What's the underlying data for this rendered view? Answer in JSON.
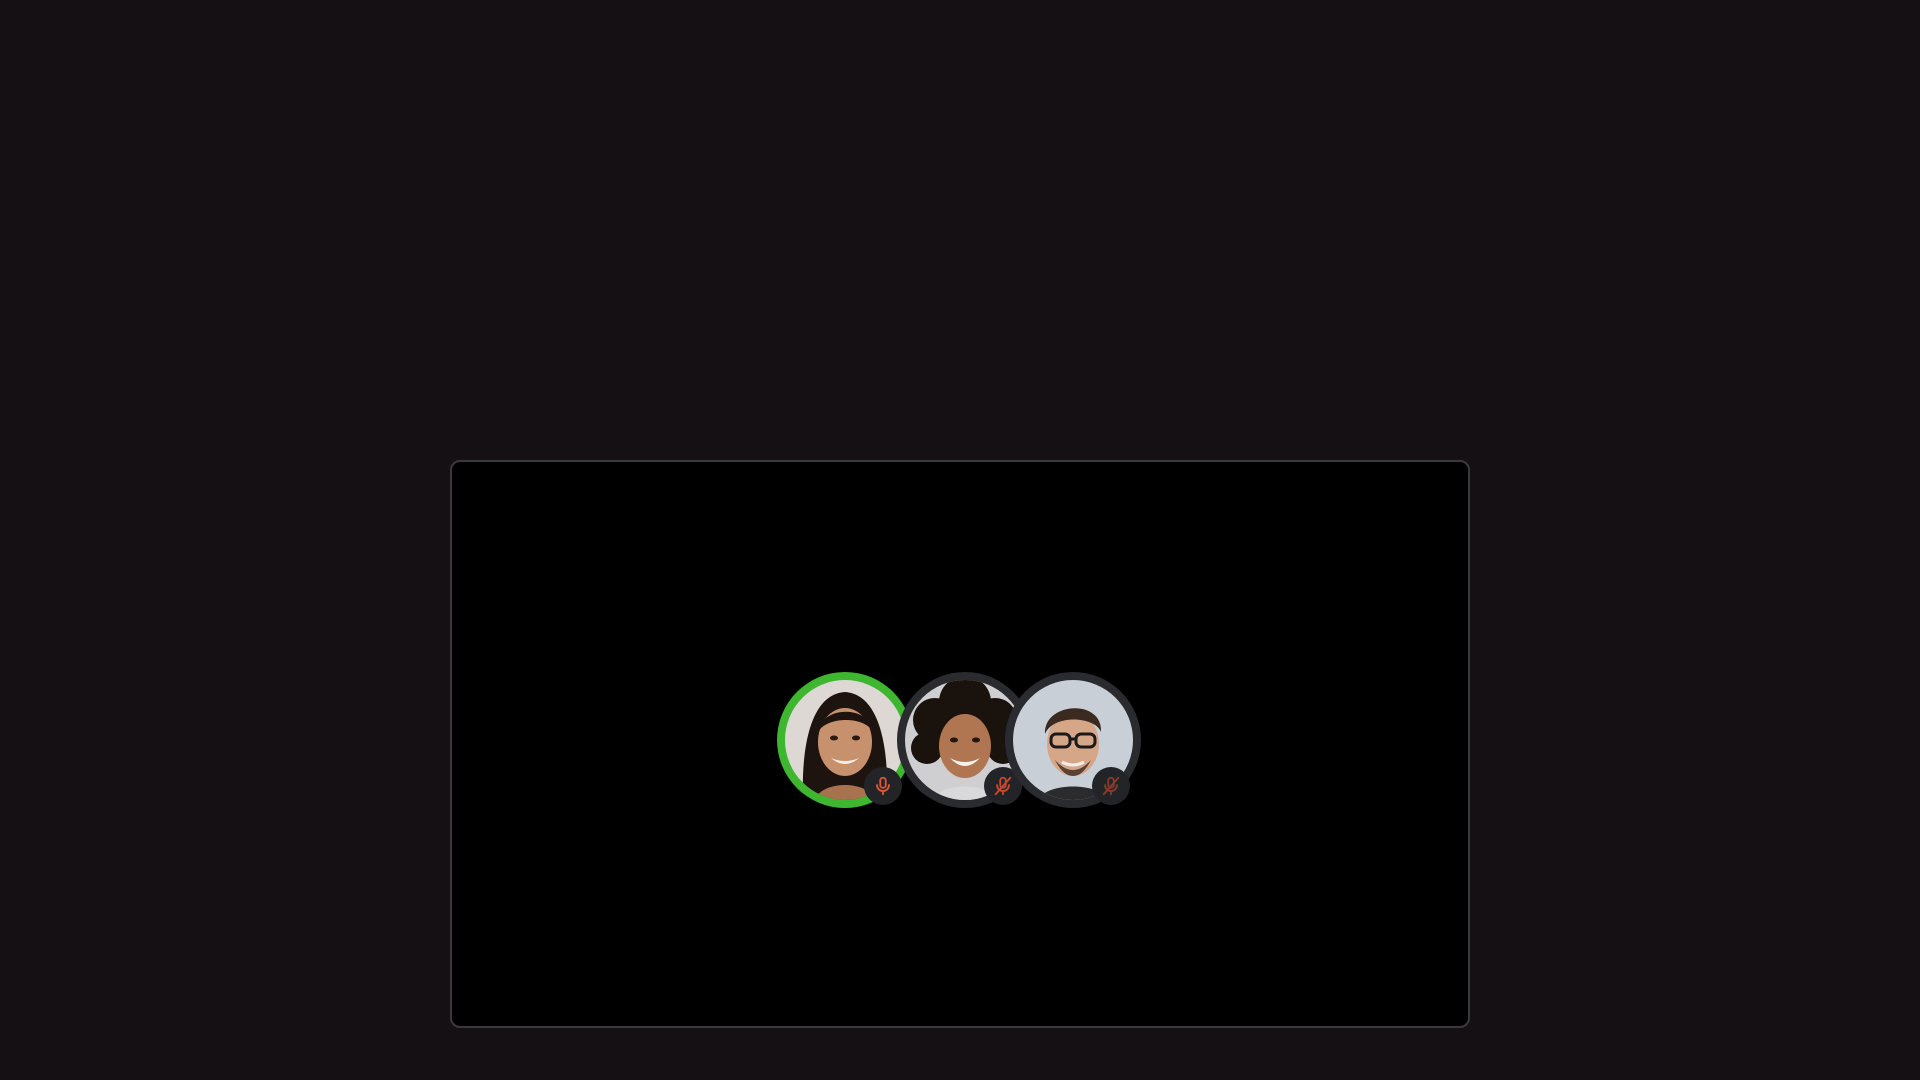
{
  "call": {
    "participants": [
      {
        "role": "speaker",
        "mic": "on",
        "skin": "#c8916d",
        "hair": "#1d1410",
        "bg": "#d9d4cf",
        "ring_color": "#3fb630",
        "mic_color": "#d9593a"
      },
      {
        "role": "participant",
        "mic": "muted",
        "skin": "#b07551",
        "hair": "#1a120d",
        "bg": "#cfcfd2",
        "ring_color": "#2a2b2f",
        "mic_color": "#c84a2e"
      },
      {
        "role": "participant",
        "mic": "muted",
        "skin": "#d6a688",
        "hair": "#3a2a20",
        "bg": "#c9cfd6",
        "ring_color": "#2a2b2f",
        "mic_color": "#8a3a28"
      }
    ],
    "icons": [
      "microphone-icon",
      "microphone-muted-icon"
    ]
  }
}
